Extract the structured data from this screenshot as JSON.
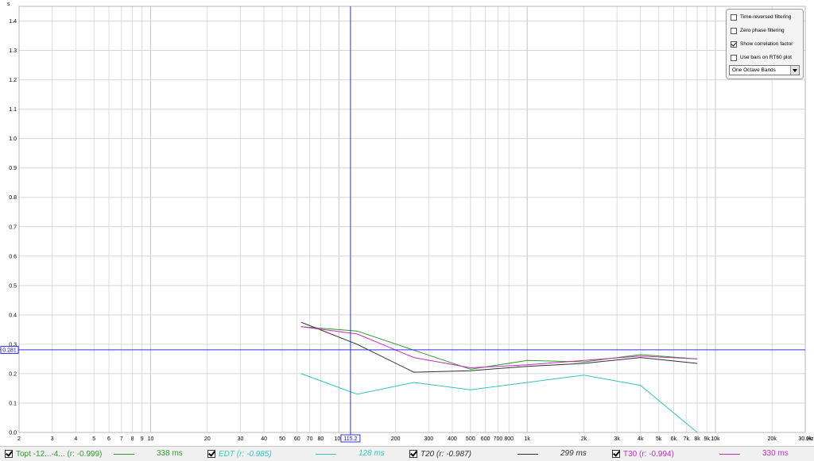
{
  "chart_data": {
    "type": "line",
    "title": "",
    "xlabel": "Hz",
    "ylabel": "s",
    "x_scale": "log",
    "xlim": [
      2,
      30000
    ],
    "ylim": [
      0,
      1.45
    ],
    "grid": true,
    "x_ticks": [
      {
        "v": 2,
        "t": "2"
      },
      {
        "v": 3,
        "t": "3"
      },
      {
        "v": 4,
        "t": "4"
      },
      {
        "v": 5,
        "t": "5"
      },
      {
        "v": 6,
        "t": "6"
      },
      {
        "v": 7,
        "t": "7"
      },
      {
        "v": 8,
        "t": "8"
      },
      {
        "v": 9,
        "t": "9"
      },
      {
        "v": 10,
        "t": "10"
      },
      {
        "v": 20,
        "t": "20"
      },
      {
        "v": 30,
        "t": "30"
      },
      {
        "v": 40,
        "t": "40"
      },
      {
        "v": 50,
        "t": "50"
      },
      {
        "v": 60,
        "t": "60"
      },
      {
        "v": 70,
        "t": "70"
      },
      {
        "v": 80,
        "t": "80"
      },
      {
        "v": 100,
        "t": "100"
      },
      {
        "v": 200,
        "t": "200"
      },
      {
        "v": 300,
        "t": "300"
      },
      {
        "v": 400,
        "t": "400"
      },
      {
        "v": 500,
        "t": "500"
      },
      {
        "v": 600,
        "t": "600"
      },
      {
        "v": 700,
        "t": "700"
      },
      {
        "v": 800,
        "t": "800"
      },
      {
        "v": 1000,
        "t": "1k"
      },
      {
        "v": 2000,
        "t": "2k"
      },
      {
        "v": 3000,
        "t": "3k"
      },
      {
        "v": 4000,
        "t": "4k"
      },
      {
        "v": 5000,
        "t": "5k"
      },
      {
        "v": 6000,
        "t": "6k"
      },
      {
        "v": 7000,
        "t": "7k"
      },
      {
        "v": 8000,
        "t": "8k"
      },
      {
        "v": 9000,
        "t": "9k"
      },
      {
        "v": 10000,
        "t": "10k"
      },
      {
        "v": 20000,
        "t": "20k"
      },
      {
        "v": 30000,
        "t": "30.0k"
      }
    ],
    "y_ticks": [
      {
        "v": 0.0,
        "t": "0.0"
      },
      {
        "v": 0.1,
        "t": "0.1"
      },
      {
        "v": 0.2,
        "t": "0.2"
      },
      {
        "v": 0.3,
        "t": "0.3"
      },
      {
        "v": 0.4,
        "t": "0.4"
      },
      {
        "v": 0.5,
        "t": "0.5"
      },
      {
        "v": 0.6,
        "t": "0.6"
      },
      {
        "v": 0.7,
        "t": "0.7"
      },
      {
        "v": 0.8,
        "t": "0.8"
      },
      {
        "v": 0.9,
        "t": "0.9"
      },
      {
        "v": 1.0,
        "t": "1.0"
      },
      {
        "v": 1.1,
        "t": "1.1"
      },
      {
        "v": 1.2,
        "t": "1.2"
      },
      {
        "v": 1.3,
        "t": "1.3"
      },
      {
        "v": 1.4,
        "t": "1.4"
      }
    ],
    "cursor": {
      "x": 115.2,
      "y": 0.281,
      "x_label": "115.2",
      "y_label": "0.281"
    },
    "x": [
      63,
      125,
      250,
      500,
      1000,
      2000,
      4000,
      8000
    ],
    "series": [
      {
        "name": "Topt -12...-4... (r: -0.999)",
        "color": "#2e9a2e",
        "values": [
          0.36,
          0.345,
          0.28,
          0.215,
          0.245,
          0.24,
          0.265,
          0.25
        ]
      },
      {
        "name": "EDT (r: -0.985)",
        "color": "#30c4c4",
        "values": [
          0.2,
          0.13,
          0.17,
          0.145,
          0.17,
          0.195,
          0.16,
          0.0
        ]
      },
      {
        "name": "T20 (r: -0.987)",
        "color": "#303030",
        "values": [
          0.375,
          0.3,
          0.205,
          0.21,
          0.225,
          0.235,
          0.255,
          0.235
        ]
      },
      {
        "name": "T30 (r: -0.994)",
        "color": "#c030c0",
        "values": [
          0.36,
          0.335,
          0.255,
          0.22,
          0.23,
          0.245,
          0.26,
          0.25
        ]
      }
    ]
  },
  "options": {
    "time_reversed": {
      "label": "Time-reversed filtering",
      "checked": false
    },
    "zero_phase": {
      "label": "Zero phase filtering",
      "checked": false
    },
    "correlation": {
      "label": "Show correlation factor",
      "checked": true
    },
    "bars": {
      "label": "Use bars on RT60 plot",
      "checked": false
    },
    "band_select": "One Octave Bands"
  },
  "legend": [
    {
      "name": "Topt -12...-4... (r: -0.999)",
      "value": "338 ms",
      "color": "#2e9a2e",
      "checked": true,
      "italic": false
    },
    {
      "name": "EDT (r: -0.985)",
      "value": "128 ms",
      "color": "#30c4c4",
      "checked": true,
      "italic": true
    },
    {
      "name": "T20 (r: -0.987)",
      "value": "299 ms",
      "color": "#303030",
      "checked": true,
      "italic": true
    },
    {
      "name": "T30 (r: -0.994)",
      "value": "330 ms",
      "color": "#c030c0",
      "checked": true,
      "italic": false
    }
  ]
}
